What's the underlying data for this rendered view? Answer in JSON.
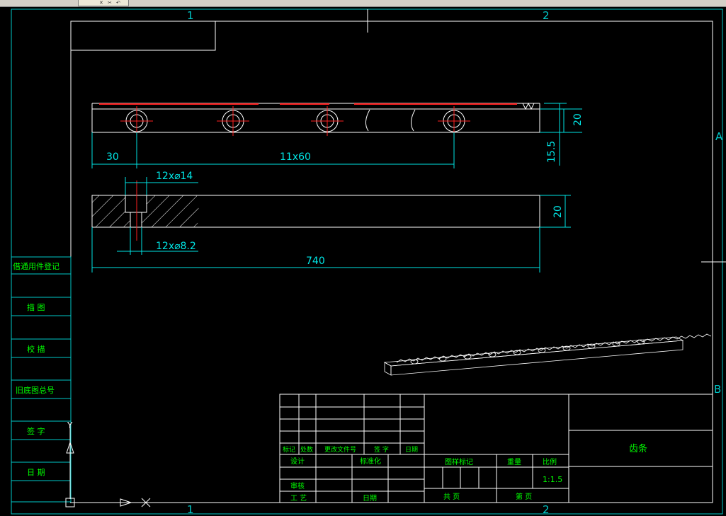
{
  "toolbar": {
    "icons": [
      "close-icon",
      "scissors-icon",
      "undo-icon"
    ]
  },
  "colors": {
    "background": "#000000",
    "frame": "#ffffff",
    "zone": "#00c8c8",
    "text": "#00ff00",
    "center": "#ff2020",
    "dim": "#00e5e5"
  },
  "frame": {
    "zone_top_1": "1",
    "zone_top_2": "2",
    "zone_bottom_1": "1",
    "zone_bottom_2": "2",
    "zone_right_a": "A",
    "zone_right_b": "B"
  },
  "side_table": [
    "借通用件登记",
    "描 图",
    "校 描",
    "旧底图总号",
    "签 字",
    "日 期"
  ],
  "dimensions": {
    "left_pitch": "30",
    "hole_pitch": "11x60",
    "height_top": "20",
    "offset": "15.5",
    "counterbore": "12x⌀14",
    "through_hole": "12x⌀8.2",
    "height_side": "20",
    "length": "740"
  },
  "title_block": {
    "revision_headers": [
      "标记",
      "处数",
      "更改文件号",
      "签 字",
      "日期"
    ],
    "row_design": "设计",
    "row_standard": "标准化",
    "row_review": "审核",
    "row_process": "工 艺",
    "row_date": "日期",
    "stage_mark": "图样标记",
    "weight": "重量",
    "scale_label": "比例",
    "scale_value": "1:1.5",
    "sheets_total": "共  页",
    "sheet_no": "第  页",
    "part_name": "齿条"
  },
  "ucs": {
    "y_label": "Y",
    "x_label": "X"
  }
}
